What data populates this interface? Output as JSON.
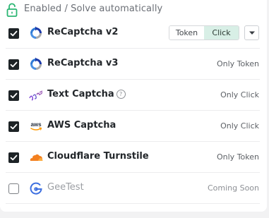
{
  "header": {
    "text": "Enabled / Solve automatically",
    "icon": "unlocked-padlock-icon",
    "accent": "#2bb673"
  },
  "rows": [
    {
      "name": "ReCaptcha v2",
      "checked": true,
      "icon": "recaptcha-icon",
      "mode_options": [
        "Token",
        "Click"
      ],
      "selected_mode": "Click"
    },
    {
      "name": "ReCaptcha v3",
      "checked": true,
      "icon": "recaptcha-icon",
      "status": "Only Token"
    },
    {
      "name": "Text Captcha",
      "checked": true,
      "icon": "text-captcha-icon",
      "help": "?",
      "status": "Only Click"
    },
    {
      "name": "AWS Captcha",
      "checked": true,
      "icon": "aws-icon",
      "logo_text": "aws",
      "status": "Only Click"
    },
    {
      "name": "Cloudflare Turnstile",
      "checked": true,
      "icon": "cloudflare-icon",
      "status": "Only Token"
    },
    {
      "name": "GeeTest",
      "checked": false,
      "icon": "geetest-icon",
      "status": "Coming Soon"
    }
  ]
}
